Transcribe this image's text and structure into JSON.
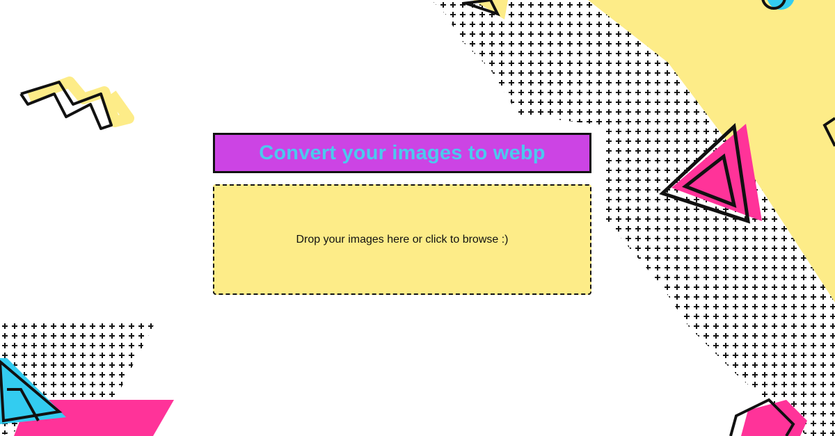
{
  "header": {
    "title": "Convert your images to webp"
  },
  "dropzone": {
    "label": "Drop your images here or click to browse :)"
  },
  "colors": {
    "title_bg": "#cc44e4",
    "title_text": "#4cc9ee",
    "dropzone_bg": "#fdec88",
    "accent_yellow": "#fdec88",
    "accent_pink": "#ff3399",
    "accent_cyan": "#33ccf0",
    "outline": "#111111"
  }
}
